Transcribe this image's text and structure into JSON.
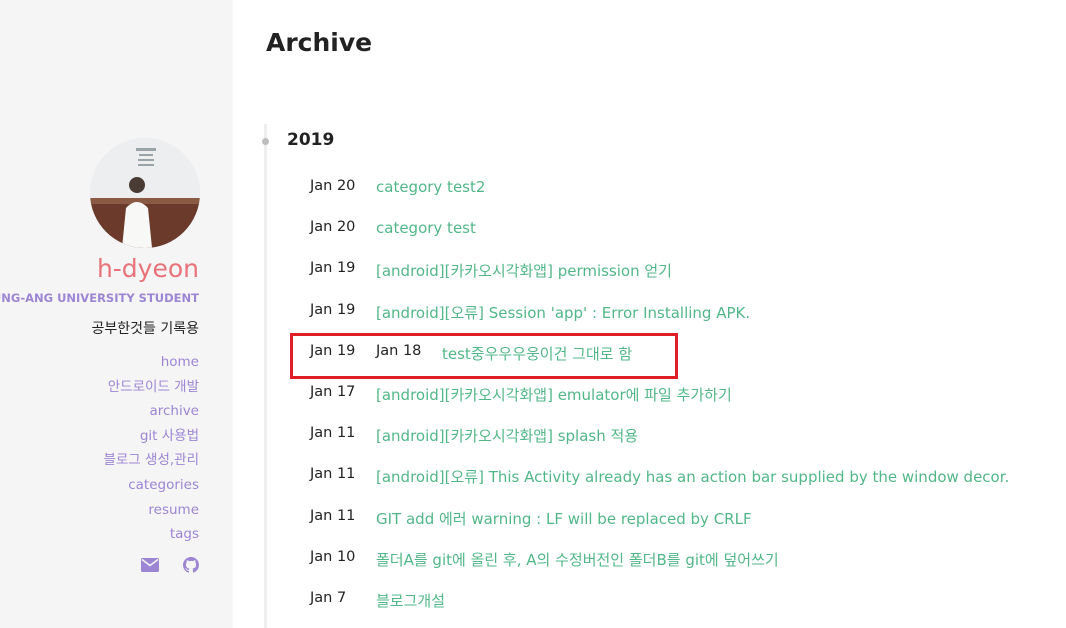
{
  "sidebar": {
    "avatar_alt": "profile image",
    "title": "h-dyeon",
    "subtitle": "CHUNG-ANG UNIVERSITY STUDENT",
    "description": "공부한것들 기록용",
    "nav": [
      "home",
      "안드로이드 개발",
      "archive",
      "git 사용법",
      "블로그 생성,관리",
      "categories",
      "resume",
      "tags"
    ],
    "social": [
      {
        "icon": "envelope-icon"
      },
      {
        "icon": "github-icon"
      }
    ],
    "colors": {
      "title": "#e8737a",
      "accent": "#9c86d4",
      "background": "#f5f5f5"
    }
  },
  "main": {
    "title": "Archive",
    "year": "2019",
    "posts": [
      {
        "date": "Jan 20",
        "title": "category test2"
      },
      {
        "date": "Jan 20",
        "title": "category test"
      },
      {
        "date": "Jan 19",
        "title": "[android][카카오시각화앱] permission 얻기"
      },
      {
        "date": "Jan 19",
        "title": "[android][오류] Session 'app' : Error Installing APK."
      },
      {
        "date": "Jan 19",
        "date2": "Jan 18",
        "title": "test중우우우웅이건 그대로 함",
        "highlighted": true
      },
      {
        "date": "Jan 17",
        "title": "[android][카카오시각화앱] emulator에 파일 추가하기"
      },
      {
        "date": "Jan 11",
        "title": "[android][카카오시각화앱] splash 적용"
      },
      {
        "date": "Jan 11",
        "title": "[android][오류] This Activity already has an action bar supplied by the window decor."
      },
      {
        "date": "Jan 11",
        "title": "GIT add 에러 warning : LF will be replaced by CRLF"
      },
      {
        "date": "Jan 10",
        "title": "폴더A를 git에 올린 후, A의 수정버전인 폴더B를 git에 덮어쓰기"
      },
      {
        "date": "Jan 7",
        "title": "블로그개설"
      }
    ],
    "colors": {
      "link": "#52b788",
      "highlight": "#e01e26"
    }
  }
}
